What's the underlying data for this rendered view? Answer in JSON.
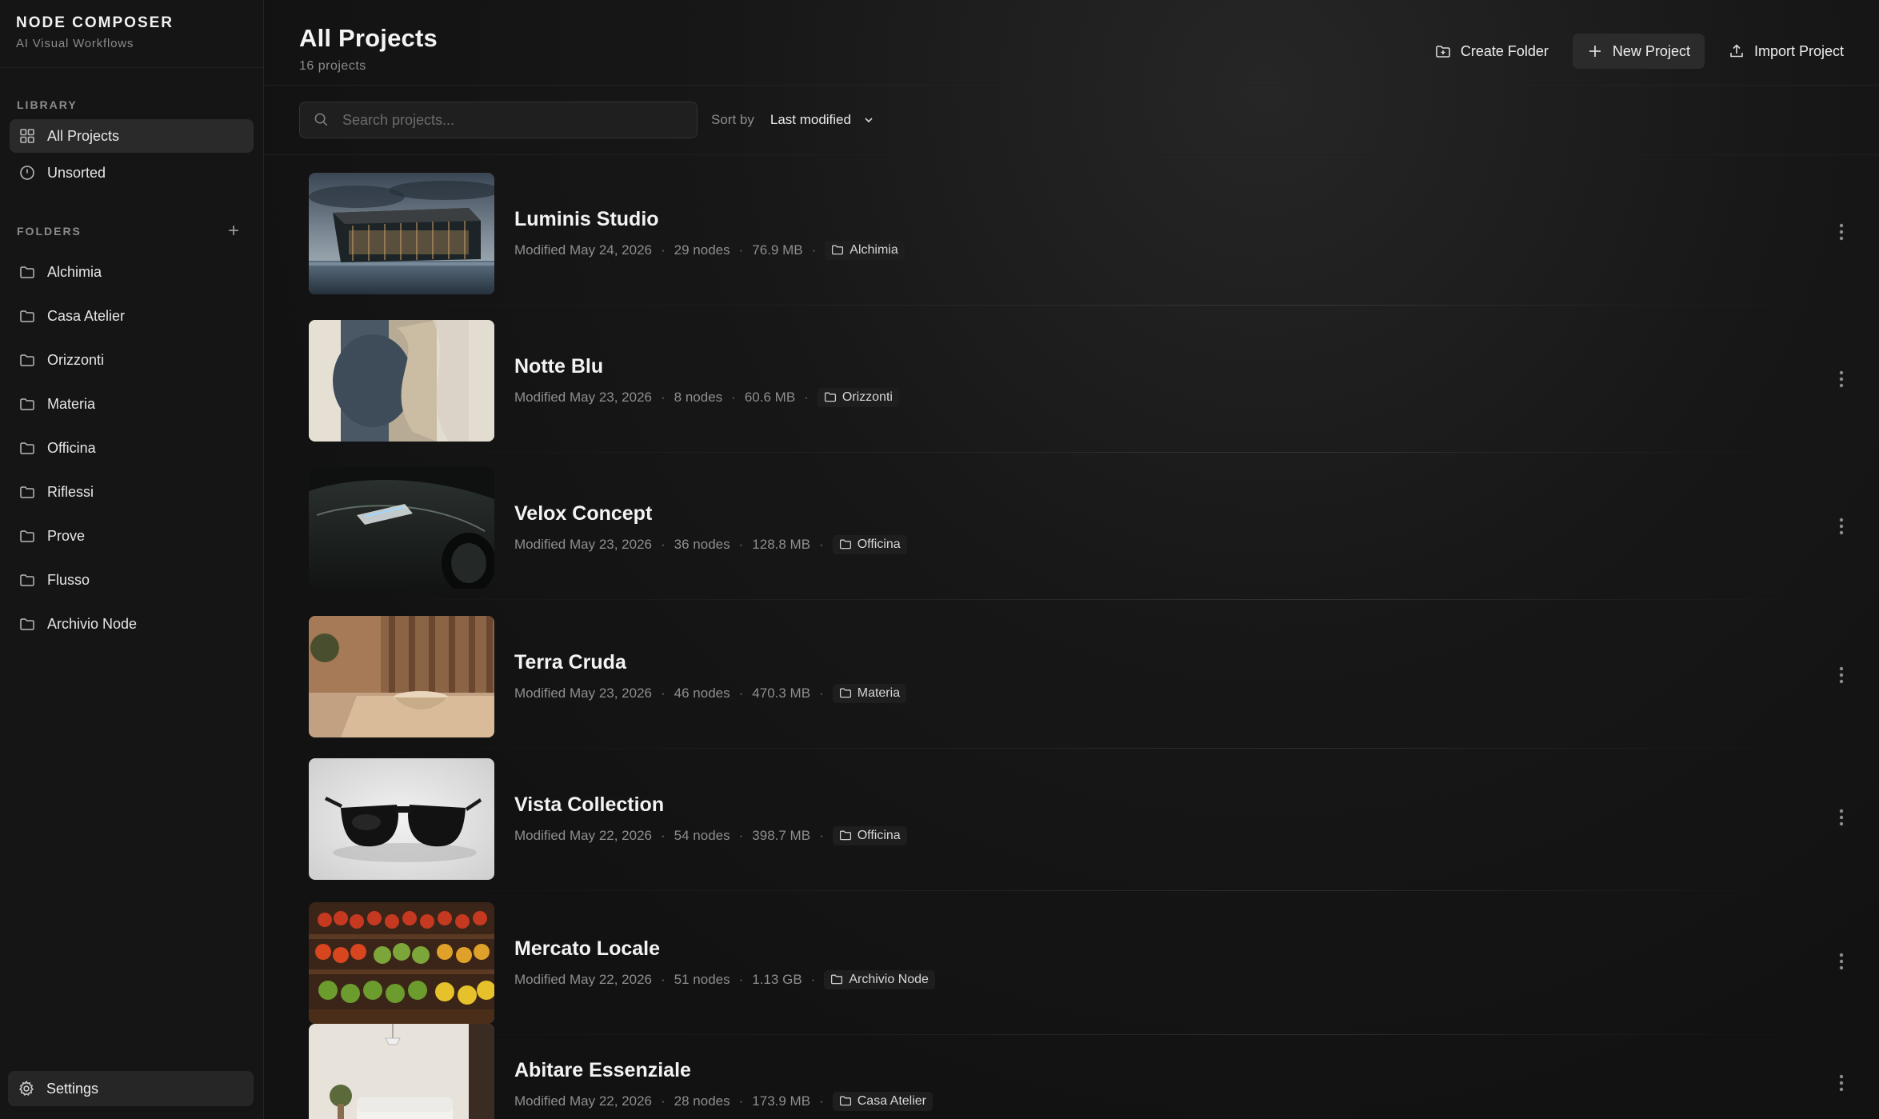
{
  "app": {
    "name": "NODE COMPOSER",
    "tagline": "AI Visual Workflows"
  },
  "sidebar": {
    "library_label": "LIBRARY",
    "library_items": [
      {
        "label": "All Projects",
        "icon": "grid-icon",
        "active": true
      },
      {
        "label": "Unsorted",
        "icon": "clock-icon",
        "active": false
      }
    ],
    "folders_label": "FOLDERS",
    "add_folder": "+",
    "folders": [
      "Alchimia",
      "Casa Atelier",
      "Orizzonti",
      "Materia",
      "Officina",
      "Riflessi",
      "Prove",
      "Flusso",
      "Archivio Node"
    ],
    "settings_label": "Settings"
  },
  "header": {
    "title": "All Projects",
    "count": "16 projects",
    "actions": {
      "create_folder": "Create Folder",
      "new_project": "New Project",
      "import_project": "Import Project"
    }
  },
  "filters": {
    "search_placeholder": "Search projects...",
    "sort_label": "Sort by",
    "sort_value": "Last modified"
  },
  "projects": [
    {
      "title": "Luminis Studio",
      "modified": "Modified May 24, 2026",
      "nodes": "29 nodes",
      "size": "76.9 MB",
      "folder": "Alchimia",
      "thumb": "glass-pavilion"
    },
    {
      "title": "Notte Blu",
      "modified": "Modified May 23, 2026",
      "nodes": "8 nodes",
      "size": "60.6 MB",
      "folder": "Orizzonti",
      "thumb": "abstract-moon"
    },
    {
      "title": "Velox Concept",
      "modified": "Modified May 23, 2026",
      "nodes": "36 nodes",
      "size": "128.8 MB",
      "folder": "Officina",
      "thumb": "dark-car"
    },
    {
      "title": "Terra Cruda",
      "modified": "Modified May 23, 2026",
      "nodes": "46 nodes",
      "size": "470.3 MB",
      "folder": "Materia",
      "thumb": "wood-bowl"
    },
    {
      "title": "Vista Collection",
      "modified": "Modified May 22, 2026",
      "nodes": "54 nodes",
      "size": "398.7 MB",
      "folder": "Officina",
      "thumb": "sunglasses"
    },
    {
      "title": "Mercato Locale",
      "modified": "Modified May 22, 2026",
      "nodes": "51 nodes",
      "size": "1.13 GB",
      "folder": "Archivio Node",
      "thumb": "produce-market"
    },
    {
      "title": "Abitare Essenziale",
      "modified": "Modified May 22, 2026",
      "nodes": "28 nodes",
      "size": "173.9 MB",
      "folder": "Casa Atelier",
      "thumb": "living-room"
    }
  ],
  "separator": "·"
}
